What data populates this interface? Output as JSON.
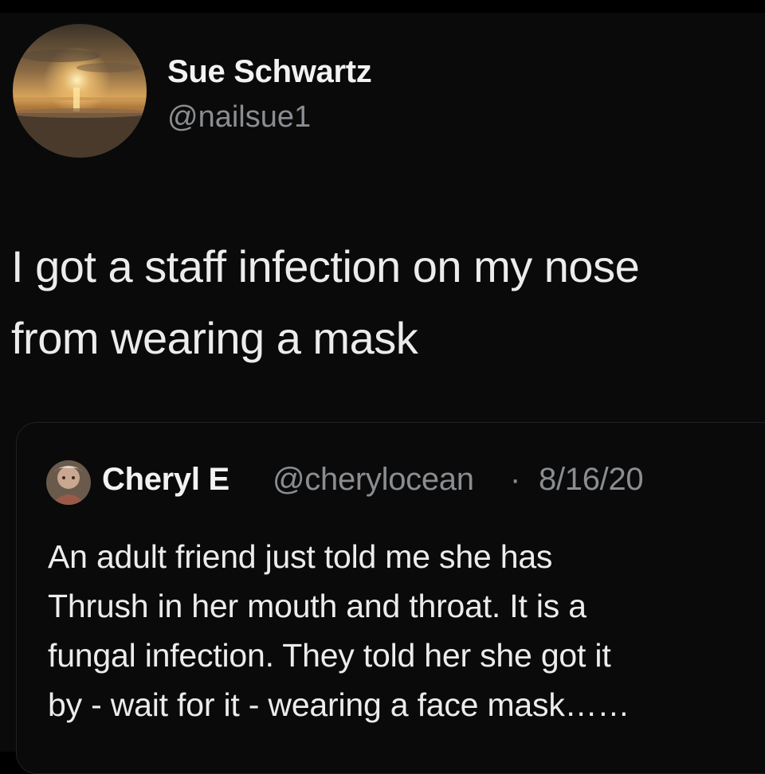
{
  "tweet": {
    "author": {
      "display_name": "Sue Schwartz",
      "handle": "@nailsue1",
      "avatar": "sunset-beach-avatar"
    },
    "text_lines": [
      "I got a staff infection on my nose",
      "from wearing a mask"
    ]
  },
  "quoted_tweet": {
    "author": {
      "display_name": "Cheryl E",
      "handle": "@cherylocean",
      "avatar": "cheryl-avatar"
    },
    "separator": "·",
    "date": "8/16/20",
    "text_lines": [
      "An adult friend just told me she has",
      "Thrush in her mouth and throat.  It is a",
      "fungal infection.  They told her she got it",
      "by - wait for it - wearing a face mask……"
    ]
  },
  "colors": {
    "background": "#0a0a0a",
    "primary_text": "#ececec",
    "secondary_text": "#8a8d91",
    "card_border": "#1e2124"
  }
}
